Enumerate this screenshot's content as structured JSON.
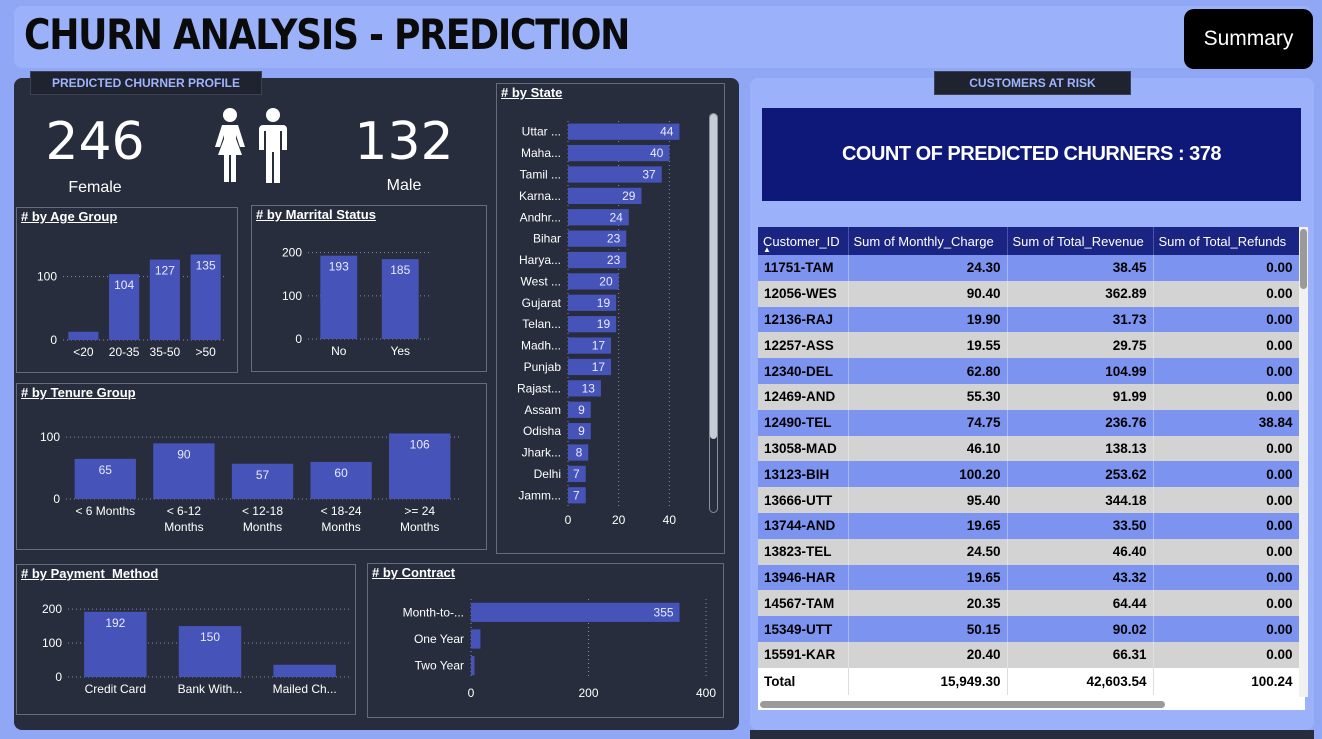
{
  "title": "CHURN ANALYSIS - PREDICTION",
  "summary_button": "Summary",
  "profile_label": "PREDICTED CHURNER PROFILE",
  "risk_label": "CUSTOMERS AT RISK",
  "gender": {
    "female_count": "246",
    "female_label": "Female",
    "male_count": "132",
    "male_label": "Male"
  },
  "count_banner": "COUNT OF PREDICTED CHURNERS : 378",
  "colors": {
    "bar": "#4653b8",
    "panel": "#272d3c",
    "banner": "#0d1878",
    "header": "#1a2583"
  },
  "chart_data": [
    {
      "type": "bar",
      "title": "# by Age Group",
      "categories": [
        "<20",
        "20-35",
        "35-50",
        ">50"
      ],
      "values": [
        13,
        104,
        127,
        135
      ],
      "data_labels": [
        "",
        "104",
        "127",
        "135"
      ],
      "yticks": [
        0,
        100
      ],
      "ylim": [
        0,
        150
      ]
    },
    {
      "type": "bar",
      "title": "# by Marrital Status",
      "categories": [
        "No",
        "Yes"
      ],
      "values": [
        193,
        185
      ],
      "yticks": [
        0,
        100,
        200
      ],
      "ylim": [
        0,
        220
      ]
    },
    {
      "type": "bar",
      "title": "# by Tenure Group",
      "categories": [
        [
          "< 6 Months"
        ],
        [
          "< 6-12",
          "Months"
        ],
        [
          "< 12-18",
          "Months"
        ],
        [
          "< 18-24",
          "Months"
        ],
        [
          ">= 24",
          "Months"
        ]
      ],
      "values": [
        65,
        90,
        57,
        60,
        106
      ],
      "yticks": [
        0,
        100
      ],
      "ylim": [
        0,
        110
      ]
    },
    {
      "type": "bar",
      "title": "# by Payment_Method",
      "categories": [
        "Credit Card",
        "Bank With...",
        "Mailed Ch..."
      ],
      "values": [
        192,
        150,
        36
      ],
      "data_labels": [
        "192",
        "150",
        ""
      ],
      "yticks": [
        0,
        100,
        200
      ],
      "ylim": [
        0,
        215
      ]
    },
    {
      "type": "bar",
      "orientation": "horizontal",
      "title": "# by Contract",
      "categories": [
        "Month-to-...",
        "One Year",
        "Two Year"
      ],
      "values": [
        355,
        16,
        6
      ],
      "data_labels": [
        "355",
        "",
        ""
      ],
      "xticks": [
        0,
        200,
        400
      ],
      "xlim": [
        0,
        400
      ]
    },
    {
      "type": "bar",
      "orientation": "horizontal",
      "title": "# by State",
      "categories": [
        "Uttar ...",
        "Maha...",
        "Tamil ...",
        "Karna...",
        "Andhr...",
        "Bihar",
        "Harya...",
        "West ...",
        "Gujarat",
        "Telan...",
        "Madh...",
        "Punjab",
        "Rajast...",
        "Assam",
        "Odisha",
        "Jhark...",
        "Delhi",
        "Jamm..."
      ],
      "values": [
        44,
        40,
        37,
        29,
        24,
        23,
        23,
        20,
        19,
        19,
        17,
        17,
        13,
        9,
        9,
        8,
        7,
        7
      ],
      "xticks": [
        0,
        20,
        40
      ],
      "xlim": [
        0,
        45
      ]
    }
  ],
  "table": {
    "columns": [
      "Customer_ID",
      "Sum of Monthly_Charge",
      "Sum of Total_Revenue",
      "Sum of Total_Refunds"
    ],
    "rows": [
      [
        "11751-TAM",
        "24.30",
        "38.45",
        "0.00"
      ],
      [
        "12056-WES",
        "90.40",
        "362.89",
        "0.00"
      ],
      [
        "12136-RAJ",
        "19.90",
        "31.73",
        "0.00"
      ],
      [
        "12257-ASS",
        "19.55",
        "29.75",
        "0.00"
      ],
      [
        "12340-DEL",
        "62.80",
        "104.99",
        "0.00"
      ],
      [
        "12469-AND",
        "55.30",
        "91.99",
        "0.00"
      ],
      [
        "12490-TEL",
        "74.75",
        "236.76",
        "38.84"
      ],
      [
        "13058-MAD",
        "46.10",
        "138.13",
        "0.00"
      ],
      [
        "13123-BIH",
        "100.20",
        "253.62",
        "0.00"
      ],
      [
        "13666-UTT",
        "95.40",
        "344.18",
        "0.00"
      ],
      [
        "13744-AND",
        "19.65",
        "33.50",
        "0.00"
      ],
      [
        "13823-TEL",
        "24.50",
        "46.40",
        "0.00"
      ],
      [
        "13946-HAR",
        "19.65",
        "43.32",
        "0.00"
      ],
      [
        "14567-TAM",
        "20.35",
        "64.44",
        "0.00"
      ],
      [
        "15349-UTT",
        "50.15",
        "90.02",
        "0.00"
      ],
      [
        "15591-KAR",
        "20.40",
        "66.31",
        "0.00"
      ]
    ],
    "total": [
      "Total",
      "15,949.30",
      "42,603.54",
      "100.24"
    ]
  }
}
